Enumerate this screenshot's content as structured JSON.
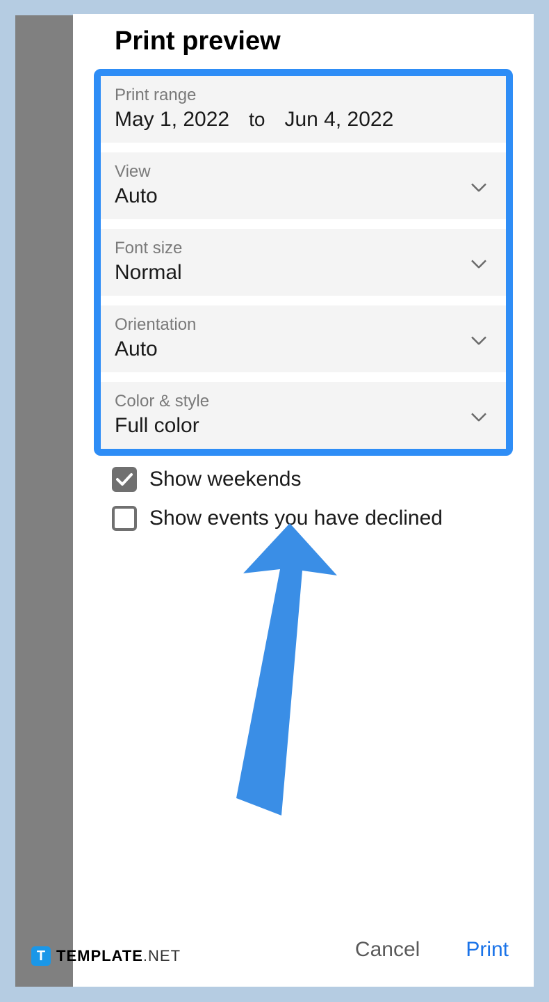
{
  "title": "Print preview",
  "fields": {
    "print_range": {
      "label": "Print range",
      "start": "May 1, 2022",
      "to": "to",
      "end": "Jun 4, 2022"
    },
    "view": {
      "label": "View",
      "value": "Auto"
    },
    "font_size": {
      "label": "Font size",
      "value": "Normal"
    },
    "orientation": {
      "label": "Orientation",
      "value": "Auto"
    },
    "color_style": {
      "label": "Color & style",
      "value": "Full color"
    }
  },
  "checkboxes": {
    "show_weekends": {
      "label": "Show weekends",
      "checked": true
    },
    "show_declined": {
      "label": "Show events you have declined",
      "checked": false
    }
  },
  "buttons": {
    "cancel": "Cancel",
    "print": "Print"
  },
  "watermark": {
    "badge": "T",
    "bold": "TEMPLATE",
    "light": ".NET"
  },
  "colors": {
    "highlight": "#2e8df6",
    "accent": "#1a73e8"
  }
}
